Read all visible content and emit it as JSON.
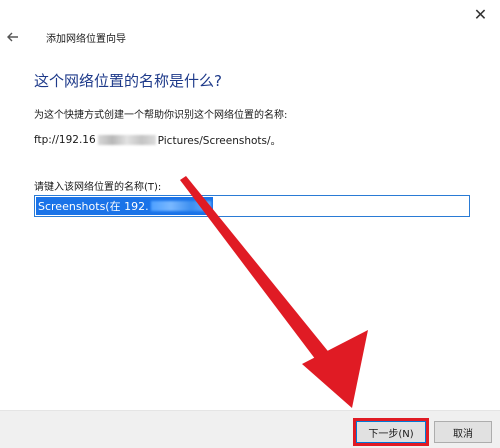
{
  "window": {
    "close_glyph": "✕",
    "back_icon": "arrow-left-icon",
    "title": "添加网络位置向导"
  },
  "main": {
    "heading": "这个网络位置的名称是什么?",
    "description": "为这个快捷方式创建一个帮助你识别这个网络位置的名称:",
    "url_prefix": "ftp://192.16",
    "url_suffix": "Pictures/Screenshots/。",
    "name_label": "请键入该网络位置的名称(T):",
    "name_value": "Screenshots(在 192."
  },
  "footer": {
    "next_label": "下一步(N)",
    "cancel_label": "取消"
  },
  "annotation": {
    "arrow_color": "#e01b24",
    "highlight_color": "#e01b24"
  },
  "colors": {
    "heading": "#1e3a8a",
    "selection": "#1a73e8",
    "input_border": "#2a7bd5"
  }
}
